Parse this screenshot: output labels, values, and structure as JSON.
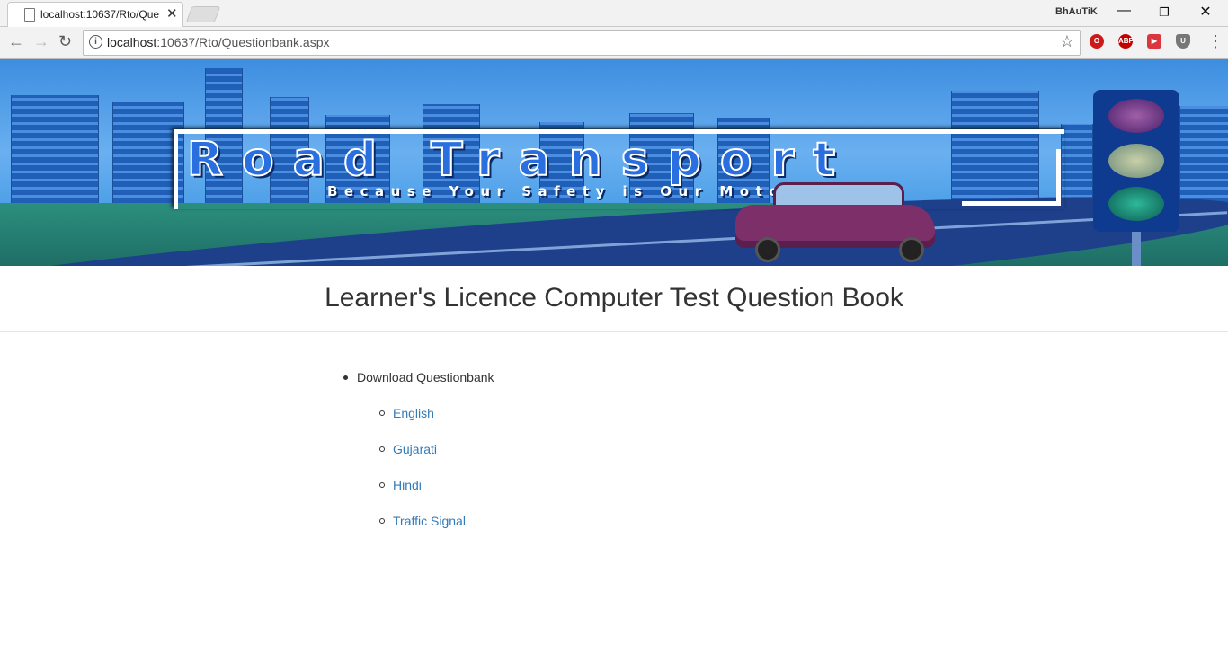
{
  "browser": {
    "tab_title": "localhost:10637/Rto/Que",
    "user_label": "BhAuTiK",
    "url_host": "localhost",
    "url_rest": ":10637/Rto/Questionbank.aspx",
    "window_controls": [
      "minimize-icon",
      "restore-icon",
      "close-icon"
    ],
    "extensions": [
      {
        "name": "opera-icon",
        "color": "#cc1a1a"
      },
      {
        "name": "adblock-plus-icon",
        "label": "ABP",
        "color": "#c20000"
      },
      {
        "name": "ext-red-icon",
        "color": "#d9363e"
      },
      {
        "name": "shield-icon",
        "color": "#777777"
      }
    ]
  },
  "banner": {
    "title": "Road Transport",
    "tagline": "Because Your Safety is Our Moto"
  },
  "page": {
    "heading": "Learner's Licence Computer Test Question Book",
    "list_item": "Download Questionbank",
    "links": [
      "English",
      "Gujarati",
      "Hindi",
      "Traffic Signal"
    ],
    "link_color": "#337ab7"
  }
}
